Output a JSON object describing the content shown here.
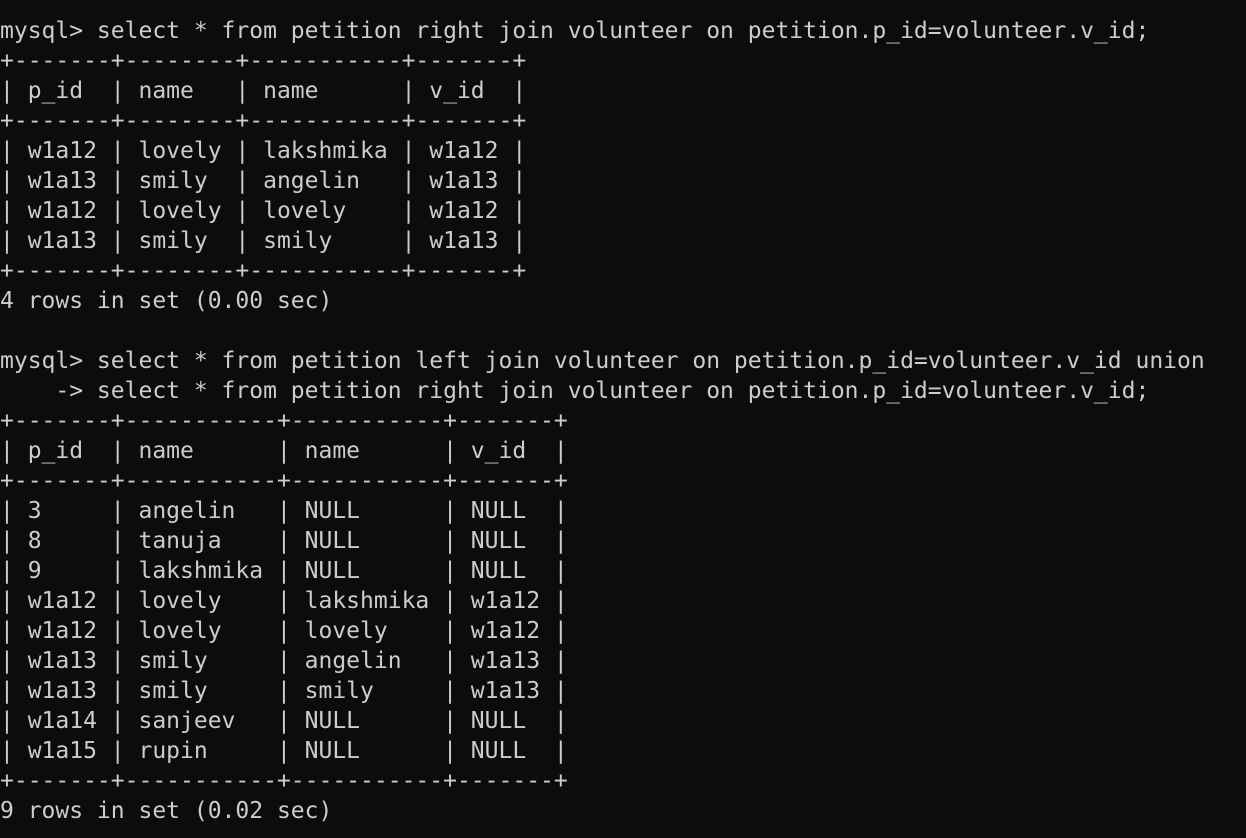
{
  "terminal": {
    "lines": [
      "mysql> select * from petition right join volunteer on petition.p_id=volunteer.v_id;",
      "+-------+--------+-----------+-------+",
      "| p_id  | name   | name      | v_id  |",
      "+-------+--------+-----------+-------+",
      "| w1a12 | lovely | lakshmika | w1a12 |",
      "| w1a13 | smily  | angelin   | w1a13 |",
      "| w1a12 | lovely | lovely    | w1a12 |",
      "| w1a13 | smily  | smily     | w1a13 |",
      "+-------+--------+-----------+-------+",
      "4 rows in set (0.00 sec)",
      "",
      "mysql> select * from petition left join volunteer on petition.p_id=volunteer.v_id union",
      "    -> select * from petition right join volunteer on petition.p_id=volunteer.v_id;",
      "+-------+-----------+-----------+-------+",
      "| p_id  | name      | name      | v_id  |",
      "+-------+-----------+-----------+-------+",
      "| 3     | angelin   | NULL      | NULL  |",
      "| 8     | tanuja    | NULL      | NULL  |",
      "| 9     | lakshmika | NULL      | NULL  |",
      "| w1a12 | lovely    | lakshmika | w1a12 |",
      "| w1a12 | lovely    | lovely    | w1a12 |",
      "| w1a13 | smily     | angelin   | w1a13 |",
      "| w1a13 | smily     | smily     | w1a13 |",
      "| w1a14 | sanjeev   | NULL      | NULL  |",
      "| w1a15 | rupin     | NULL      | NULL  |",
      "+-------+-----------+-----------+-------+",
      "9 rows in set (0.02 sec)"
    ]
  },
  "colors": {
    "background": "#0c0c0c",
    "text": "#cccccc"
  }
}
